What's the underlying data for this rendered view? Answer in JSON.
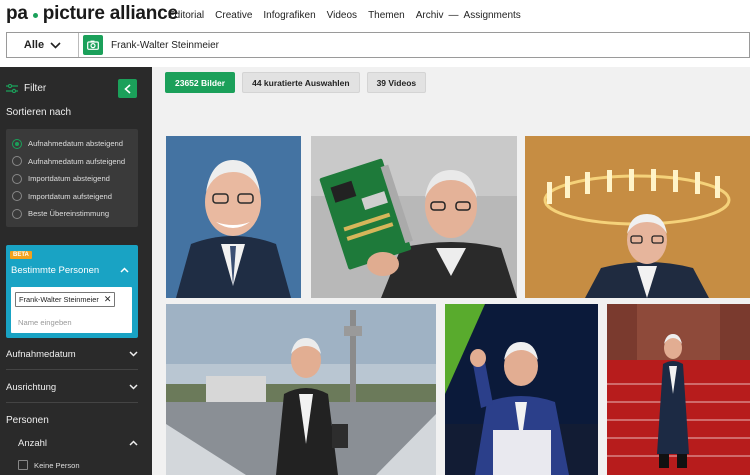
{
  "header": {
    "logo_left": "pa",
    "logo_right": "picture alliance",
    "nav": [
      "Editorial",
      "Creative",
      "Infografiken",
      "Videos",
      "Themen",
      "Archiv",
      "—",
      "Assignments"
    ]
  },
  "search": {
    "scope": "Alle",
    "query": "Frank-Walter Steinmeier"
  },
  "sidebar": {
    "filter_label": "Filter",
    "sort_title": "Sortieren nach",
    "sort_options": [
      "Aufnahmedatum absteigend",
      "Aufnahmedatum aufsteigend",
      "Importdatum absteigend",
      "Importdatum aufsteigend",
      "Beste Übereinstimmung"
    ],
    "sort_selected_index": 0,
    "persons": {
      "badge": "BETA",
      "title": "Bestimmte Personen",
      "tag": "Frank-Walter Steinmeier",
      "input_placeholder": "Name eingeben"
    },
    "facets": [
      "Aufnahmedatum",
      "Ausrichtung"
    ],
    "personen_title": "Personen",
    "anzahl_label": "Anzahl",
    "checkbox_label": "Keine Person"
  },
  "results": {
    "tabs": [
      "23652 Bilder",
      "44 kuratierte Auswahlen",
      "39 Videos"
    ],
    "active_tab": 0
  },
  "colors": {
    "brand_green": "#1ba05a",
    "panel_blue": "#19a3c4",
    "beta_orange": "#f3a21c",
    "sidebar_bg": "#2a2a2a"
  }
}
